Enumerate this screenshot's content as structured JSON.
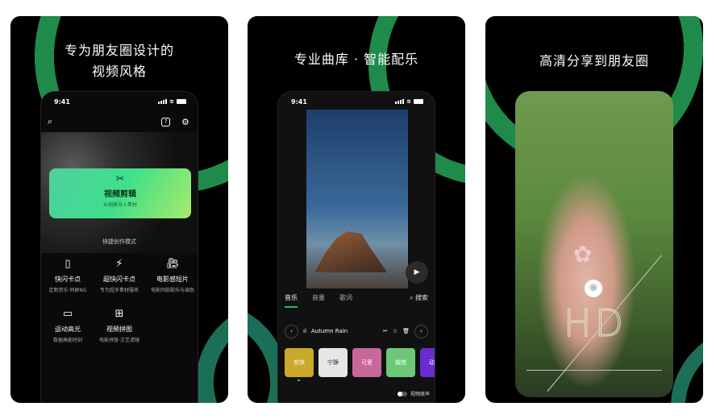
{
  "panels": [
    {
      "headline_line1": "专为朋友圈设计的",
      "headline_line2": "视频风格",
      "phone": {
        "time": "9:41",
        "hero_title": "视频剪辑",
        "hero_subtitle": "从相册导入素材",
        "section_title": "快捷创作模式",
        "modes": [
          {
            "icon": "flash-card-icon",
            "title": "快闪卡点",
            "subtitle": "定制音乐·同屏NG"
          },
          {
            "icon": "lightning-icon",
            "title": "超快闪卡点",
            "subtitle": "专为超多素材服务"
          },
          {
            "icon": "movie-camera-icon",
            "title": "电影感短片",
            "subtitle": "电影同款配乐与调色"
          },
          {
            "icon": "highlight-icon",
            "title": "运动高光",
            "subtitle": "数据高能时刻"
          },
          {
            "icon": "collage-icon",
            "title": "视频拼图",
            "subtitle": "电影拼版·文艺滤镜"
          }
        ]
      }
    },
    {
      "headline": "专业曲库 · 智能配乐",
      "phone": {
        "time": "9:41",
        "tabs": [
          "音乐",
          "音量",
          "歌词"
        ],
        "active_tab": "音乐",
        "search_label": "搜索",
        "track_name": "Autumn Rain",
        "moods": [
          {
            "label": "欢快",
            "color": "#c9a82a"
          },
          {
            "label": "宁静",
            "color": "#e6e6e6"
          },
          {
            "label": "可爱",
            "color": "#c9679a"
          },
          {
            "label": "愉悦",
            "color": "#6cc777"
          },
          {
            "label": "动感",
            "color": "#6a2bd0"
          }
        ],
        "toggle_label": "视频原声"
      }
    },
    {
      "headline": "高清分享到朋友圈",
      "hd_text": "HD"
    }
  ],
  "colors": {
    "accent": "#1fbf64",
    "arc": "#1f7a45",
    "background": "#000000"
  }
}
